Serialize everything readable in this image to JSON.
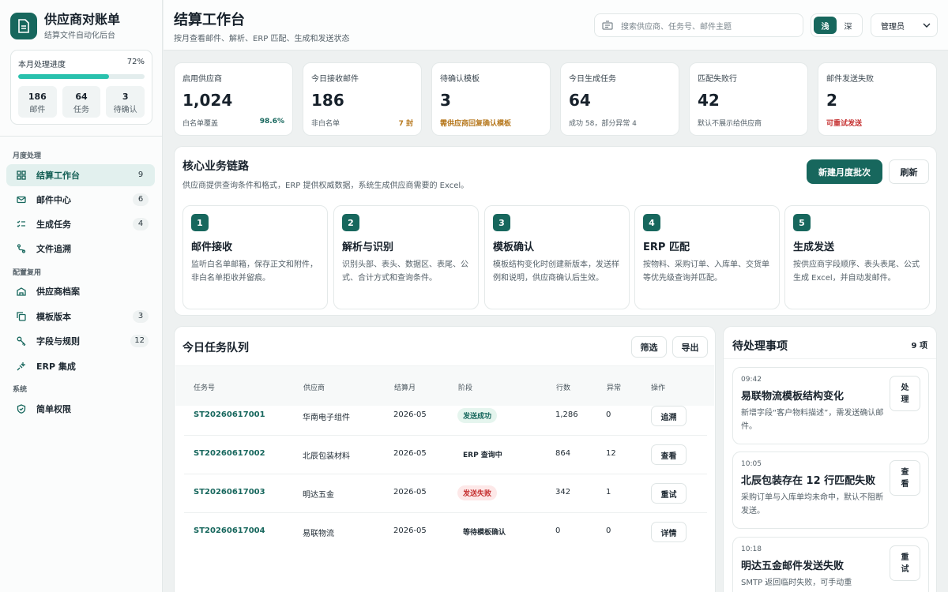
{
  "brand": {
    "title": "供应商对账单",
    "subtitle": "结算文件自动化后台"
  },
  "progress": {
    "label": "本月处理进度",
    "percent_label": "72%",
    "value": 0.72,
    "stats": [
      {
        "value": "186",
        "label": "邮件"
      },
      {
        "value": "64",
        "label": "任务"
      },
      {
        "value": "3",
        "label": "待确认"
      }
    ]
  },
  "nav": {
    "sections": [
      "月度处理",
      "配置复用",
      "系统"
    ],
    "items": [
      {
        "label": "结算工作台",
        "count": "9",
        "icon": "dashboard-grid-icon"
      },
      {
        "label": "邮件中心",
        "count": "6",
        "icon": "mail-icon"
      },
      {
        "label": "生成任务",
        "count": "4",
        "icon": "checklist-icon"
      },
      {
        "label": "文件追溯",
        "count": "",
        "icon": "route-icon"
      },
      {
        "label": "供应商档案",
        "count": "",
        "icon": "building-icon"
      },
      {
        "label": "模板版本",
        "count": "3",
        "icon": "copy-icon"
      },
      {
        "label": "字段与规则",
        "count": "12",
        "icon": "key-icon"
      },
      {
        "label": "ERP 集成",
        "count": "",
        "icon": "plug-icon"
      },
      {
        "label": "简单权限",
        "count": "",
        "icon": "shield-icon"
      }
    ]
  },
  "header": {
    "title": "结算工作台",
    "subtitle": "按月查看邮件、解析、ERP 匹配、生成和发送状态",
    "search_placeholder": "搜索供应商、任务号、邮件主题",
    "theme_light": "浅",
    "theme_dark": "深",
    "role": "管理员"
  },
  "kpis": [
    {
      "label": "启用供应商",
      "value": "1,024",
      "foot_left": "白名单覆盖",
      "foot_right": "98.6%",
      "tone": "acc"
    },
    {
      "label": "今日接收邮件",
      "value": "186",
      "foot_left": "非白名单",
      "foot_right": "7 封",
      "tone": "warn"
    },
    {
      "label": "待确认模板",
      "value": "3",
      "foot_left": "需供应商回复确认模板",
      "foot_right": "",
      "tone": "warn"
    },
    {
      "label": "今日生成任务",
      "value": "64",
      "foot_left": "成功 58，部分异常 4",
      "foot_right": "",
      "tone": ""
    },
    {
      "label": "匹配失败行",
      "value": "42",
      "foot_left": "默认不展示给供应商",
      "foot_right": "",
      "tone": ""
    },
    {
      "label": "邮件发送失败",
      "value": "2",
      "foot_left": "可重试发送",
      "foot_right": "",
      "tone": "err"
    }
  ],
  "chain": {
    "title": "核心业务链路",
    "desc": "供应商提供查询条件和格式，ERP 提供权威数据，系统生成供应商需要的 Excel。",
    "new_batch": "新建月度批次",
    "refresh": "刷新",
    "steps": [
      {
        "num": "1",
        "title": "邮件接收",
        "desc": "监听白名单邮箱，保存正文和附件，非白名单拒收并留痕。"
      },
      {
        "num": "2",
        "title": "解析与识别",
        "desc": "识别头部、表头、数据区、表尾、公式、合计方式和查询条件。"
      },
      {
        "num": "3",
        "title": "模板确认",
        "desc": "模板结构变化时创建新版本，发送样例和说明，供应商确认后生效。"
      },
      {
        "num": "4",
        "title": "ERP 匹配",
        "desc": "按物料、采购订单、入库单、交货单等优先级查询并匹配。"
      },
      {
        "num": "5",
        "title": "生成发送",
        "desc": "按供应商字段顺序、表头表尾、公式生成 Excel，并自动发邮件。"
      }
    ]
  },
  "tasks": {
    "title": "今日任务队列",
    "filter": "筛选",
    "export": "导出",
    "columns": [
      "任务号",
      "供应商",
      "结算月",
      "阶段",
      "行数",
      "异常",
      "操作"
    ],
    "rows": [
      {
        "id": "ST20260617001",
        "supplier": "华南电子组件",
        "month": "2026-05",
        "stage": "发送成功",
        "stage_tone": "ok",
        "lines": "1,286",
        "errors": "0",
        "action": "追溯"
      },
      {
        "id": "ST20260617002",
        "supplier": "北辰包装材料",
        "month": "2026-05",
        "stage": "ERP 查询中",
        "stage_tone": "plain",
        "lines": "864",
        "errors": "12",
        "action": "查看"
      },
      {
        "id": "ST20260617003",
        "supplier": "明达五金",
        "month": "2026-05",
        "stage": "发送失败",
        "stage_tone": "err",
        "lines": "342",
        "errors": "1",
        "action": "重试"
      },
      {
        "id": "ST20260617004",
        "supplier": "易联物流",
        "month": "2026-05",
        "stage": "等待模板确认",
        "stage_tone": "plain",
        "lines": "0",
        "errors": "0",
        "action": "详情"
      }
    ]
  },
  "todo": {
    "title": "待处理事项",
    "count": "9 项",
    "items": [
      {
        "time": "09:42",
        "title": "易联物流模板结构变化",
        "desc": "新增字段“客户物料描述”，需发送确认邮件。",
        "action": "处理"
      },
      {
        "time": "10:05",
        "title": "北辰包装存在 12 行匹配失败",
        "desc": "采购订单与入库单均未命中，默认不阻断发送。",
        "action": "查看"
      },
      {
        "time": "10:18",
        "title": "明达五金邮件发送失败",
        "desc": "SMTP 返回临时失败，可手动重",
        "action": "重试"
      }
    ]
  },
  "colors": {
    "accent": "#17675d",
    "progress": "#29c1ad",
    "error": "#c53030",
    "warning": "#b7791f"
  }
}
